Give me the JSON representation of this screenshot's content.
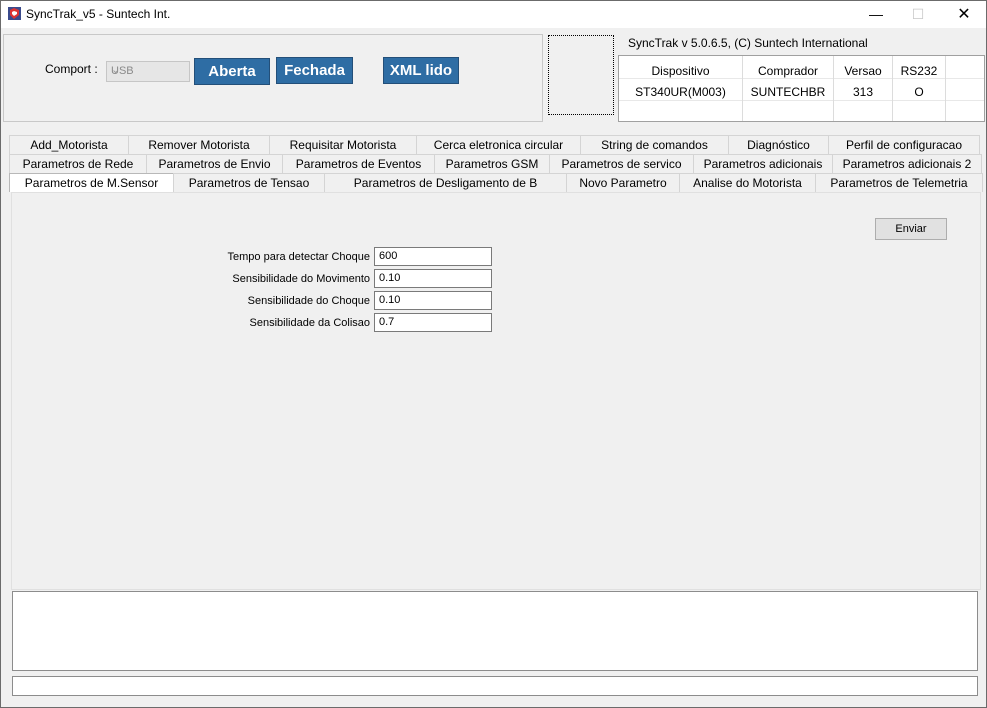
{
  "window": {
    "title": "SyncTrak_v5 - Suntech Int.",
    "controls": {
      "minimize": "—",
      "maximize": "☐",
      "close": "✕"
    }
  },
  "connection": {
    "comport_label": "Comport :",
    "comport_value": "USB",
    "buttons": {
      "open": "Aberta",
      "close": "Fechada",
      "xml": "XML lido"
    }
  },
  "version_text": "SyncTrak v 5.0.6.5, (C) Suntech International",
  "device_info": {
    "headers": [
      "Dispositivo",
      "Comprador",
      "Versao",
      "RS232"
    ],
    "values": [
      "ST340UR(M003)",
      "SUNTECHBR",
      "313",
      "O"
    ]
  },
  "tabs": {
    "row1": [
      "Add_Motorista",
      "Remover Motorista",
      "Requisitar Motorista",
      "Cerca eletronica circular",
      "String de comandos",
      "Diagnóstico",
      "Perfil de configuracao"
    ],
    "row2": [
      "Parametros de Rede",
      "Parametros de Envio",
      "Parametros de Eventos",
      "Parametros GSM",
      "Parametros de servico",
      "Parametros adicionais",
      "Parametros adicionais 2"
    ],
    "row3": [
      "Parametros  de M.Sensor",
      "Parametros de Tensao",
      "Parametros de Desligamento de B",
      "Novo Parametro",
      "Analise do Motorista",
      "Parametros de Telemetria"
    ],
    "active": "Parametros  de M.Sensor"
  },
  "form": {
    "send_button": "Enviar",
    "fields": [
      {
        "label": "Tempo para detectar Choque",
        "value": "600"
      },
      {
        "label": "Sensibilidade do Movimento",
        "value": "0.10"
      },
      {
        "label": "Sensibilidade do Choque",
        "value": "0.10"
      },
      {
        "label": "Sensibilidade da Colisao",
        "value": "0.7"
      }
    ]
  },
  "log_text": "",
  "status_text": "",
  "colors": {
    "accent_button": "#2e6da4",
    "window_bg": "#f0f0f0"
  }
}
